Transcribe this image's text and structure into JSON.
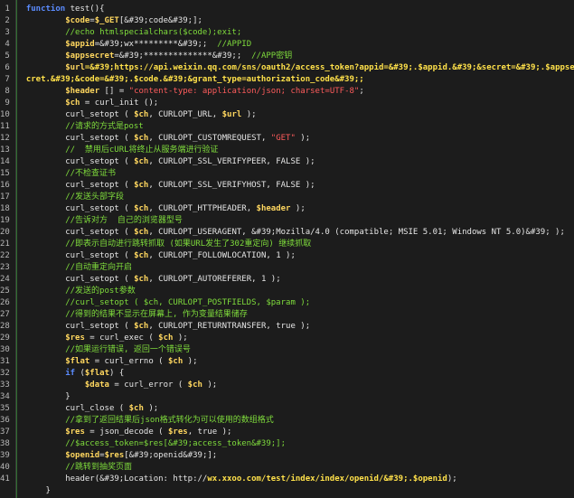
{
  "editor": {
    "line_numbers": [
      "1",
      "2",
      "3",
      "4",
      "5",
      "6",
      "7",
      "8",
      "9",
      "10",
      "11",
      "12",
      "13",
      "14",
      "15",
      "16",
      "17",
      "18",
      "19",
      "20",
      "21",
      "22",
      "23",
      "24",
      "25",
      "26",
      "27",
      "28",
      "29",
      "30",
      "31",
      "32",
      "33",
      "34",
      "35",
      "36",
      "37",
      "38",
      "39",
      "40",
      "41"
    ],
    "lines": [
      [
        {
          "t": "function",
          "c": "kw"
        },
        {
          "t": " test(){",
          "c": "plain"
        }
      ],
      [
        {
          "t": "        ",
          "c": "plain"
        },
        {
          "t": "$code",
          "c": "var"
        },
        {
          "t": "=",
          "c": "plain"
        },
        {
          "t": "$_GET",
          "c": "var"
        },
        {
          "t": "[&#39;code&#39;];",
          "c": "plain"
        }
      ],
      [
        {
          "t": "        //echo htmlspecialchars($code);exit;",
          "c": "cm"
        }
      ],
      [
        {
          "t": "        ",
          "c": "plain"
        },
        {
          "t": "$appid",
          "c": "var"
        },
        {
          "t": "=&#39;wx*********&#39;;  ",
          "c": "plain"
        },
        {
          "t": "//APPID",
          "c": "cm"
        }
      ],
      [
        {
          "t": "        ",
          "c": "plain"
        },
        {
          "t": "$appsecret",
          "c": "var"
        },
        {
          "t": "=&#39;**************&#39;;  ",
          "c": "plain"
        },
        {
          "t": "//APP密钥",
          "c": "cm"
        }
      ],
      [
        {
          "t": "        ",
          "c": "plain"
        },
        {
          "t": "$url",
          "c": "var"
        },
        {
          "t": "=&#39;https://api.weixin.qq.com/sns/oauth2/access_token?appid=&#39;.$appid.&#39;&secret=&#39;.$appse",
          "c": "yellow"
        }
      ],
      [
        {
          "t": "cret.&#39;&code=&#39;.$code.&#39;&grant_type=authorization_code&#39;;",
          "c": "yellow"
        }
      ],
      [
        {
          "t": "        ",
          "c": "plain"
        },
        {
          "t": "$header",
          "c": "var"
        },
        {
          "t": " [] = ",
          "c": "plain"
        },
        {
          "t": "\"content-type: application/json; charset=UTF-8\"",
          "c": "str"
        },
        {
          "t": ";",
          "c": "plain"
        }
      ],
      [
        {
          "t": "        ",
          "c": "plain"
        },
        {
          "t": "$ch",
          "c": "var"
        },
        {
          "t": " = curl_init ();",
          "c": "plain"
        }
      ],
      [
        {
          "t": "        curl_setopt ( ",
          "c": "plain"
        },
        {
          "t": "$ch",
          "c": "var"
        },
        {
          "t": ", CURLOPT_URL, ",
          "c": "plain"
        },
        {
          "t": "$url",
          "c": "var"
        },
        {
          "t": " );",
          "c": "plain"
        }
      ],
      [
        {
          "t": "        //请求的方式是post",
          "c": "cm"
        }
      ],
      [
        {
          "t": "        curl_setopt ( ",
          "c": "plain"
        },
        {
          "t": "$ch",
          "c": "var"
        },
        {
          "t": ", CURLOPT_CUSTOMREQUEST, ",
          "c": "plain"
        },
        {
          "t": "\"GET\"",
          "c": "str"
        },
        {
          "t": " );",
          "c": "plain"
        }
      ],
      [
        {
          "t": "        //  禁用后cURL将终止从服务端进行验证",
          "c": "cm"
        }
      ],
      [
        {
          "t": "        curl_setopt ( ",
          "c": "plain"
        },
        {
          "t": "$ch",
          "c": "var"
        },
        {
          "t": ", CURLOPT_SSL_VERIFYPEER, FALSE );",
          "c": "plain"
        }
      ],
      [
        {
          "t": "        //不检查证书",
          "c": "cm"
        }
      ],
      [
        {
          "t": "        curl_setopt ( ",
          "c": "plain"
        },
        {
          "t": "$ch",
          "c": "var"
        },
        {
          "t": ", CURLOPT_SSL_VERIFYHOST, FALSE );",
          "c": "plain"
        }
      ],
      [
        {
          "t": "        //发送头部字段",
          "c": "cm"
        }
      ],
      [
        {
          "t": "        curl_setopt ( ",
          "c": "plain"
        },
        {
          "t": "$ch",
          "c": "var"
        },
        {
          "t": ", CURLOPT_HTTPHEADER, ",
          "c": "plain"
        },
        {
          "t": "$header",
          "c": "var"
        },
        {
          "t": " );",
          "c": "plain"
        }
      ],
      [
        {
          "t": "        //告诉对方  自己的浏览器型号",
          "c": "cm"
        }
      ],
      [
        {
          "t": "        curl_setopt ( ",
          "c": "plain"
        },
        {
          "t": "$ch",
          "c": "var"
        },
        {
          "t": ", CURLOPT_USERAGENT, &#39;Mozilla/4.0 (compatible; MSIE 5.01; Windows NT 5.0)&#39; );",
          "c": "plain"
        }
      ],
      [
        {
          "t": "        //即表示自动进行跳转抓取 (如果URL发生了302重定向) 继续抓取",
          "c": "cm"
        }
      ],
      [
        {
          "t": "        curl_setopt ( ",
          "c": "plain"
        },
        {
          "t": "$ch",
          "c": "var"
        },
        {
          "t": ", CURLOPT_FOLLOWLOCATION, 1 );",
          "c": "plain"
        }
      ],
      [
        {
          "t": "        //自动重定向开启",
          "c": "cm"
        }
      ],
      [
        {
          "t": "        curl_setopt ( ",
          "c": "plain"
        },
        {
          "t": "$ch",
          "c": "var"
        },
        {
          "t": ", CURLOPT_AUTOREFERER, 1 );",
          "c": "plain"
        }
      ],
      [
        {
          "t": "        //发送的post参数",
          "c": "cm"
        }
      ],
      [
        {
          "t": "        //curl_setopt ( $ch, CURLOPT_POSTFIELDS, $param );",
          "c": "cm"
        }
      ],
      [
        {
          "t": "        //得到的结果不显示在屏幕上, 作为变量结果储存",
          "c": "cm"
        }
      ],
      [
        {
          "t": "        curl_setopt ( ",
          "c": "plain"
        },
        {
          "t": "$ch",
          "c": "var"
        },
        {
          "t": ", CURLOPT_RETURNTRANSFER, true );",
          "c": "plain"
        }
      ],
      [
        {
          "t": "        ",
          "c": "plain"
        },
        {
          "t": "$res",
          "c": "var"
        },
        {
          "t": " = curl_exec ( ",
          "c": "plain"
        },
        {
          "t": "$ch",
          "c": "var"
        },
        {
          "t": " );",
          "c": "plain"
        }
      ],
      [
        {
          "t": "        //如果运行错误, 返回一个错误号",
          "c": "cm"
        }
      ],
      [
        {
          "t": "        ",
          "c": "plain"
        },
        {
          "t": "$flat",
          "c": "var"
        },
        {
          "t": " = curl_errno ( ",
          "c": "plain"
        },
        {
          "t": "$ch",
          "c": "var"
        },
        {
          "t": " );",
          "c": "plain"
        }
      ],
      [
        {
          "t": "        ",
          "c": "plain"
        },
        {
          "t": "if",
          "c": "kw"
        },
        {
          "t": " (",
          "c": "plain"
        },
        {
          "t": "$flat",
          "c": "var"
        },
        {
          "t": ") {",
          "c": "plain"
        }
      ],
      [
        {
          "t": "            ",
          "c": "plain"
        },
        {
          "t": "$data",
          "c": "var"
        },
        {
          "t": " = curl_error ( ",
          "c": "plain"
        },
        {
          "t": "$ch",
          "c": "var"
        },
        {
          "t": " );",
          "c": "plain"
        }
      ],
      [
        {
          "t": "        }",
          "c": "plain"
        }
      ],
      [
        {
          "t": "        curl_close ( ",
          "c": "plain"
        },
        {
          "t": "$ch",
          "c": "var"
        },
        {
          "t": " );",
          "c": "plain"
        }
      ],
      [
        {
          "t": "        //拿到了返回结果后json格式转化为可以使用的数组格式",
          "c": "cm"
        }
      ],
      [
        {
          "t": "        ",
          "c": "plain"
        },
        {
          "t": "$res",
          "c": "var"
        },
        {
          "t": " = json_decode ( ",
          "c": "plain"
        },
        {
          "t": "$res",
          "c": "var"
        },
        {
          "t": ", true );",
          "c": "plain"
        }
      ],
      [
        {
          "t": "        //$access_token=$res[&#39;access_token&#39;];",
          "c": "cm"
        }
      ],
      [
        {
          "t": "        ",
          "c": "plain"
        },
        {
          "t": "$openid",
          "c": "var"
        },
        {
          "t": "=",
          "c": "plain"
        },
        {
          "t": "$res",
          "c": "var"
        },
        {
          "t": "[&#39;openid&#39;];",
          "c": "plain"
        }
      ],
      [
        {
          "t": "        //跳转到抽奖页面",
          "c": "cm"
        }
      ],
      [
        {
          "t": "        header(&#39;Location: http://",
          "c": "plain"
        },
        {
          "t": "wx.xxoo.com/test/index/index/openid/&#39;.$openid",
          "c": "yellow"
        },
        {
          "t": ");",
          "c": "plain"
        }
      ],
      [
        {
          "t": "    }",
          "c": "plain"
        }
      ]
    ],
    "colors": {
      "background": "#1c1c1c",
      "keyword": "#5b8cff",
      "variable": "#ffd75f",
      "comment": "#7fdc3c",
      "string": "#ff5c5c",
      "plain": "#e6e6e6"
    }
  }
}
